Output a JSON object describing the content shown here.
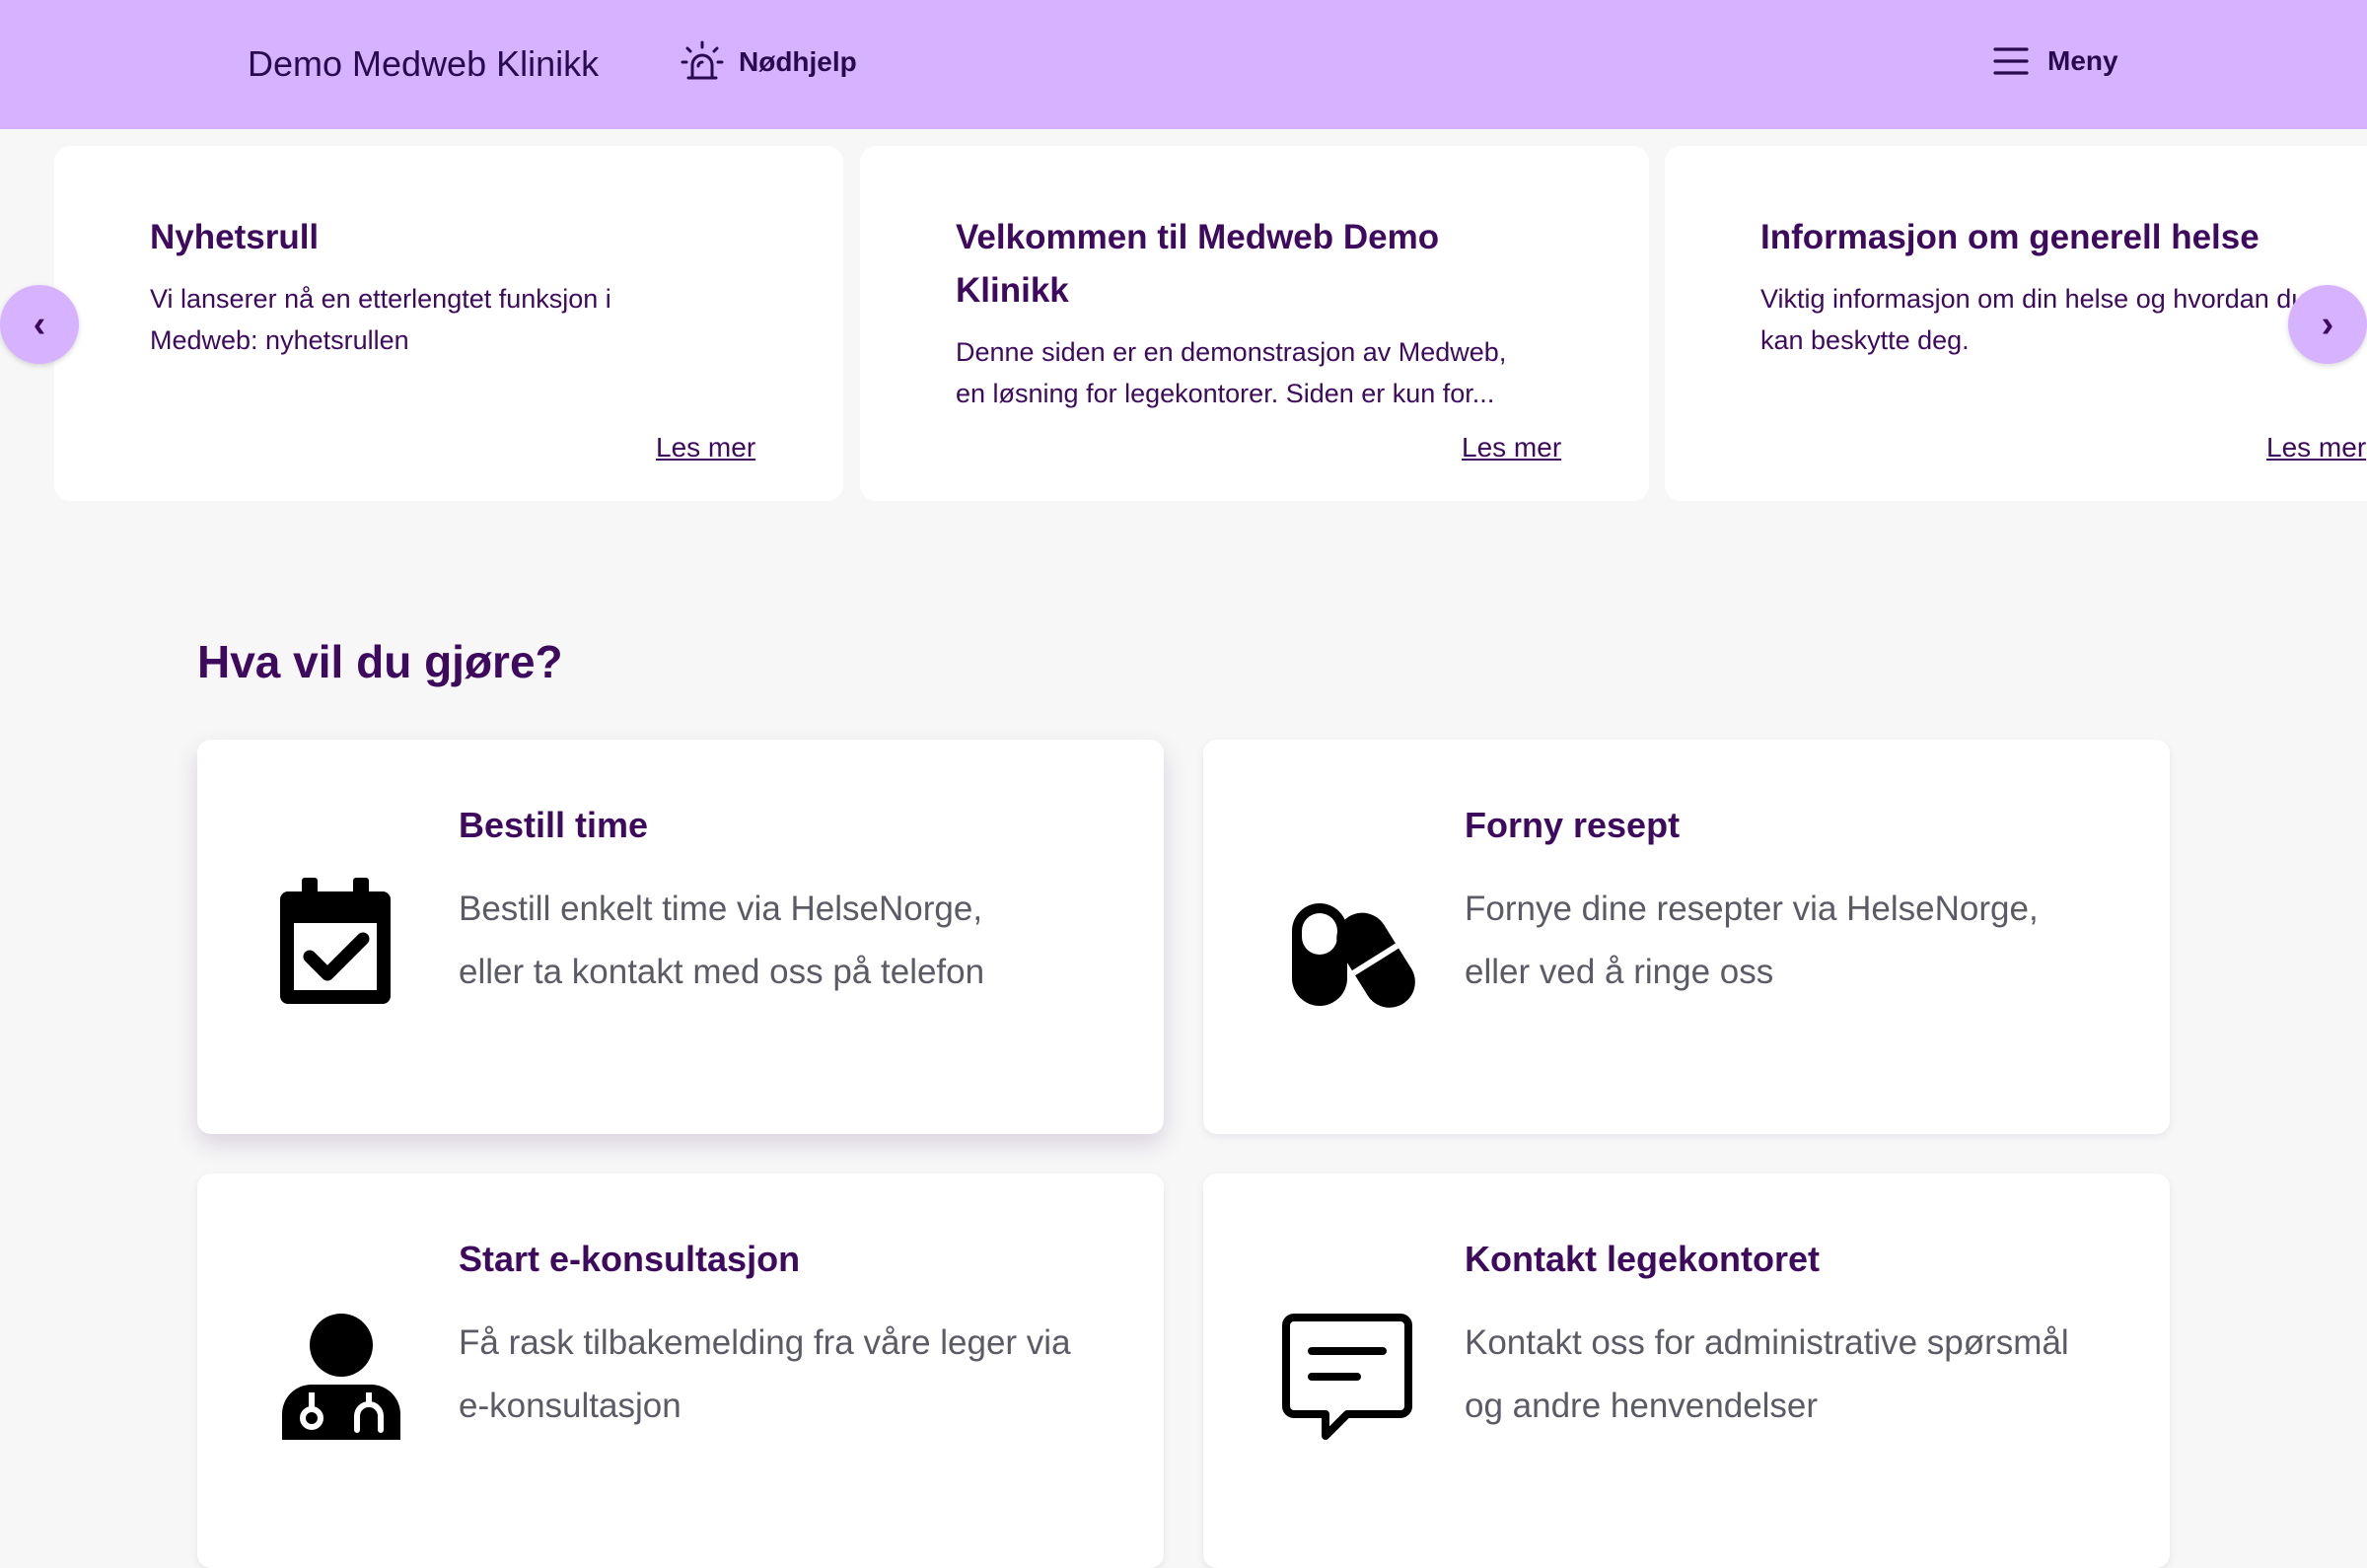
{
  "header": {
    "brand": "Demo Medweb Klinikk",
    "emergency_label": "Nødhjelp",
    "emergency_icon": "siren-icon",
    "menu_label": "Meny",
    "menu_icon": "hamburger-icon"
  },
  "carousel": {
    "prev_label": "‹",
    "next_label": "›",
    "cards": [
      {
        "title": "Nyhetsrull",
        "text_line1": "Vi lanserer nå en etterlengtet funksjon i",
        "text_line2": "Medweb: nyhetsrullen",
        "link": "Les mer"
      },
      {
        "title_line1": "Velkommen til Medweb Demo",
        "title_line2": "Klinikk",
        "text_line1": "Denne siden er en demonstrasjon av Medweb,",
        "text_line2": "en løsning for legekontorer. Siden er kun for...",
        "link": "Les mer"
      },
      {
        "title": "Informasjon om generell helse",
        "text_line1": "Viktig informasjon om din helse og hvordan du",
        "text_line2": "kan beskytte deg.",
        "link": "Les mer"
      }
    ]
  },
  "actions": {
    "title": "Hva vil du gjøre?",
    "items": [
      {
        "title": "Bestill time",
        "line1": "Bestill enkelt time via HelseNorge,",
        "line2": "eller ta kontakt med oss på telefon",
        "icon": "calendar-check-icon"
      },
      {
        "title": "Forny resept",
        "line1": "Fornye dine resepter via HelseNorge,",
        "line2": "eller ved å ringe oss",
        "icon": "pills-icon"
      },
      {
        "title": "Start e-konsultasjon",
        "line1": "Få rask tilbakemelding fra våre leger via",
        "line2": "e-konsultasjon",
        "icon": "doctor-icon"
      },
      {
        "title": "Kontakt legekontoret",
        "line1": "Kontakt oss for administrative spørsmål",
        "line2": "og andre henvendelser",
        "icon": "chat-message-icon"
      }
    ]
  },
  "colors": {
    "header_bg": "#d7b3ff",
    "accent_text": "#3d0a5e",
    "body_text": "#5b5b66",
    "page_bg": "#f7f7f7"
  }
}
